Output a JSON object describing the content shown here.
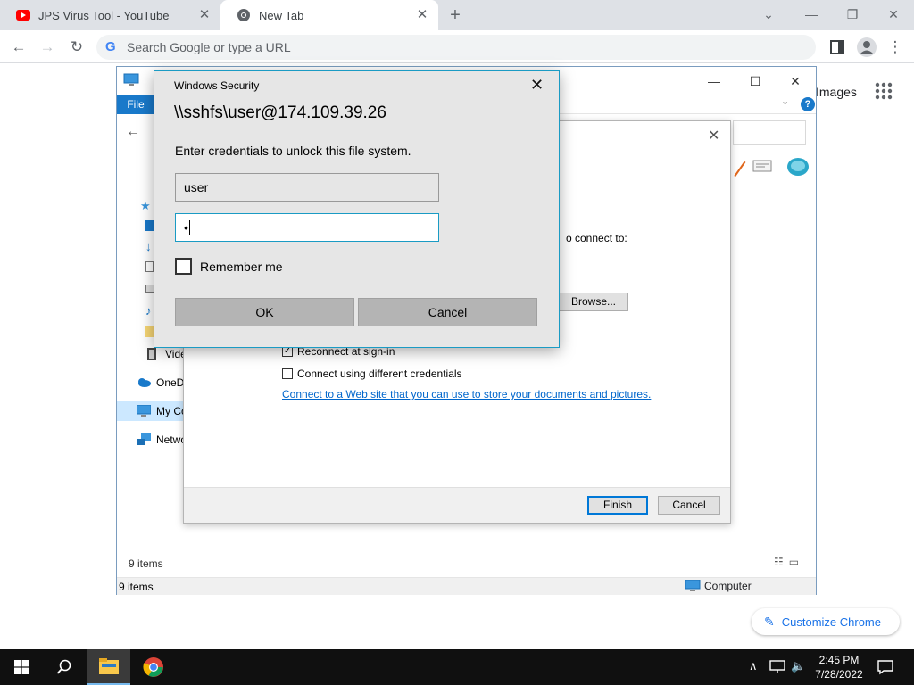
{
  "browser": {
    "tabs": [
      {
        "title": "JPS Virus Tool - YouTube",
        "icon": "youtube-icon",
        "active": false
      },
      {
        "title": "New Tab",
        "icon": "chrome-icon",
        "active": true
      }
    ],
    "omnibox_placeholder": "Search Google or type a URL",
    "new_tab_page": {
      "images_label": "Images",
      "customize_label": "Customize Chrome"
    }
  },
  "explorer": {
    "ribbon_file_label": "File",
    "nav": [
      {
        "label": "Vide",
        "icon": "video-folder-icon"
      },
      {
        "label": "OneD",
        "icon": "onedrive-icon"
      },
      {
        "label": "My Co",
        "icon": "computer-icon"
      },
      {
        "label": "Netwo",
        "icon": "network-icon"
      }
    ],
    "status_items_top": "9 items",
    "status_items": "9 items",
    "status_location": "Computer"
  },
  "wizard": {
    "connect_to_text": "o connect to:",
    "browse_label": "Browse...",
    "reconnect_label": "Reconnect at sign-in",
    "reconnect_checked": true,
    "different_credentials_label": "Connect using different credentials",
    "different_credentials_checked": false,
    "web_link": "Connect to a Web site that you can use to store your documents and pictures",
    "web_link_suffix": ".",
    "finish_label": "Finish",
    "cancel_label": "Cancel"
  },
  "security_dialog": {
    "title": "Windows Security",
    "host": "\\\\sshfs\\user@174.109.39.26",
    "description": "Enter credentials to unlock this file system.",
    "username_value": "user",
    "password_value": "•",
    "remember_label": "Remember me",
    "remember_checked": false,
    "ok_label": "OK",
    "cancel_label": "Cancel"
  },
  "taskbar": {
    "time": "2:45 PM",
    "date": "7/28/2022"
  },
  "colors": {
    "accent": "#1a9bc4",
    "chrome_tabstrip": "#dee1e6",
    "taskbar": "#101010",
    "explorer_ribbon": "#1979ca",
    "link": "#0066cc"
  }
}
